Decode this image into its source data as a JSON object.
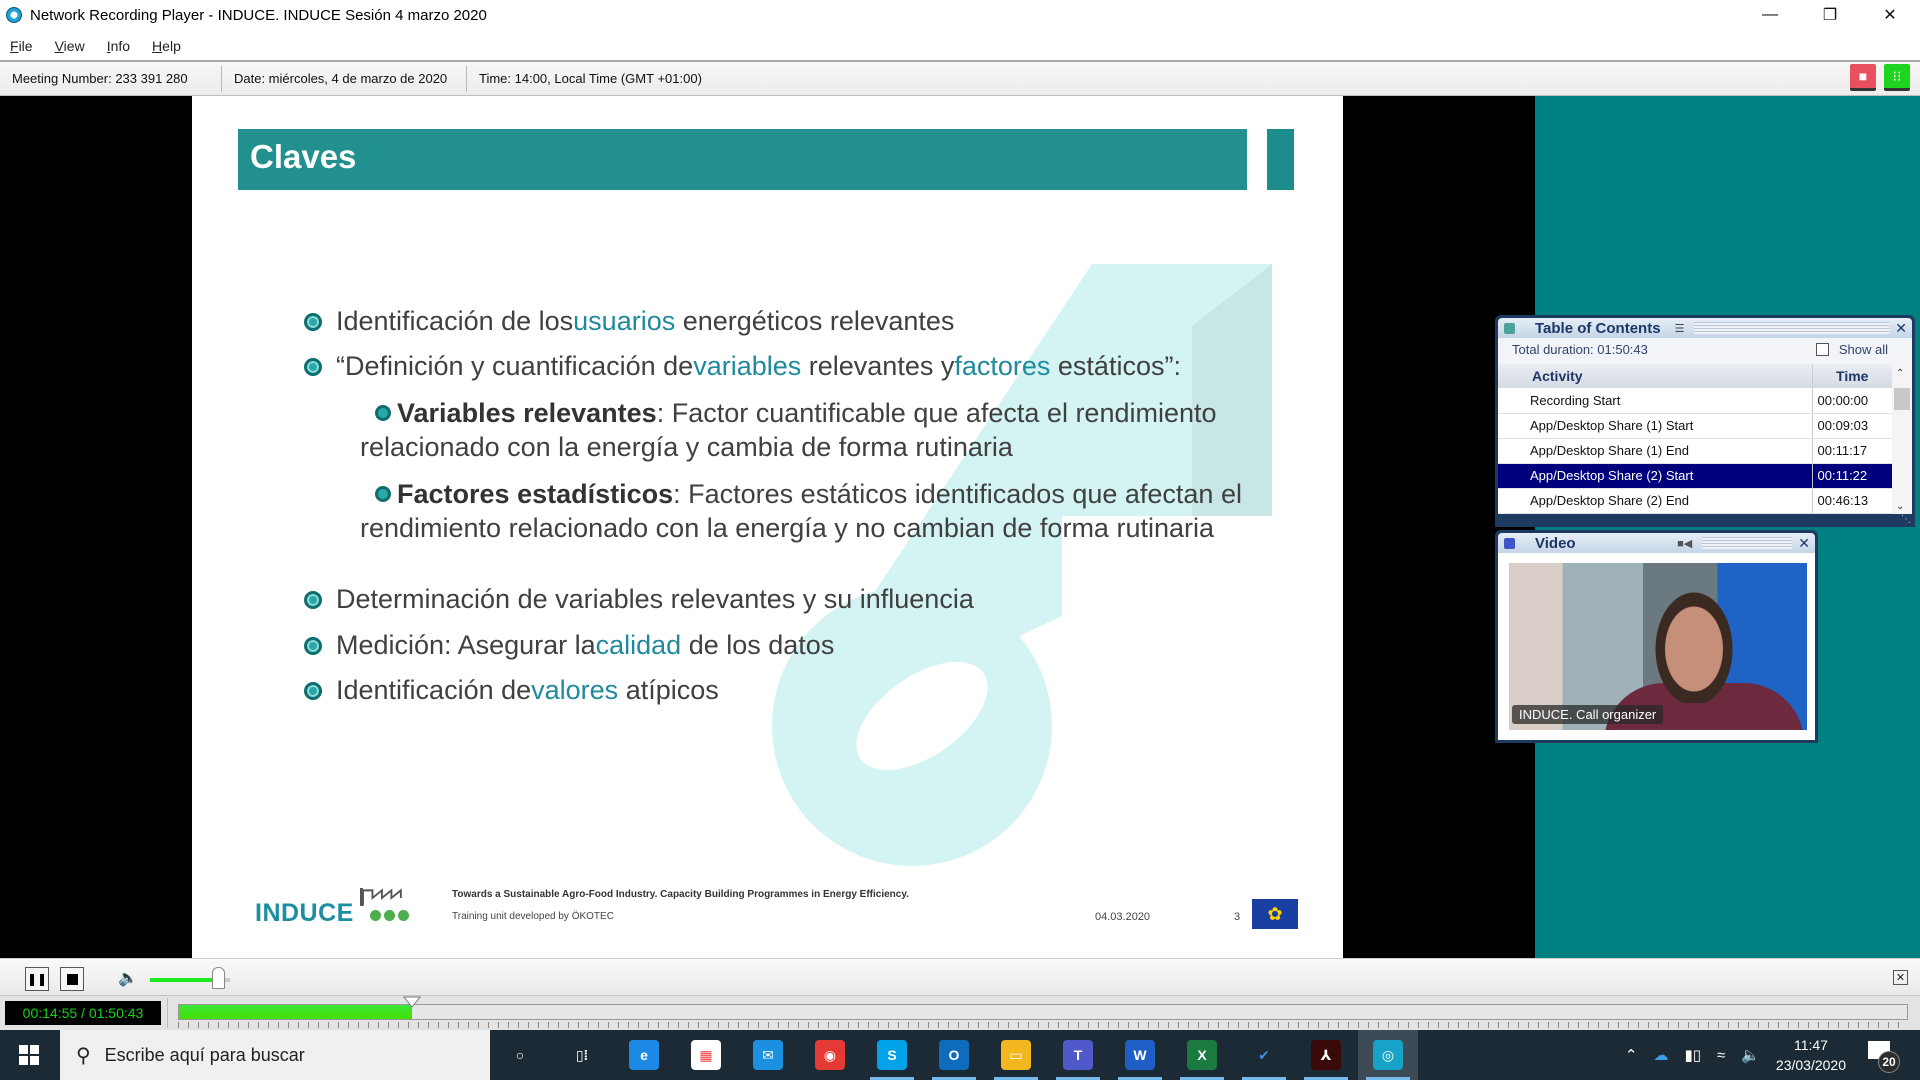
{
  "window": {
    "title": "Network Recording Player - INDUCE. INDUCE Sesión 4 marzo 2020",
    "minimize_icon": "minimize-icon",
    "restore_icon": "restore-icon",
    "close_icon": "close-icon"
  },
  "menu": [
    {
      "underline": "F",
      "rest": "ile"
    },
    {
      "underline": "V",
      "rest": "iew"
    },
    {
      "underline": "I",
      "rest": "nfo"
    },
    {
      "underline": "H",
      "rest": "elp"
    }
  ],
  "info_bar": {
    "meeting_number": "Meeting Number: 233 391 280",
    "date": "Date: miércoles, 4 de marzo de 2020",
    "time": "Time: 14:00, Local Time (GMT +01:00)",
    "chat_icon": "chat-icon",
    "participants_icon": "participants-icon",
    "colors": {
      "chat": "#e8505f",
      "participants": "#1ed41e"
    }
  },
  "slide": {
    "title": "Claves",
    "accent_color": "#21908f",
    "highlight_color": "#1e8a9c",
    "bullets": [
      {
        "parts": [
          "Identificación de los ",
          "usuarios",
          " energéticos relevantes"
        ]
      },
      {
        "parts": [
          "“Definición y cuantificación de ",
          "variables",
          " relevantes y ",
          "factores",
          " estáticos”:"
        ]
      },
      {
        "bold": "Variables relevantes",
        "text": ": Factor cuantificable que afecta el rendimiento relacionado con la energía y cambia de forma rutinaria"
      },
      {
        "bold": "Factores estadísticos",
        "text": ": Factores estáticos identificados que afectan el rendimiento relacionado con la energía y no cambian de forma rutinaria"
      },
      {
        "parts": [
          "Determinación de variables relevantes y su influencia"
        ]
      },
      {
        "parts": [
          "Medición: Asegurar la ",
          "calidad",
          " de los datos"
        ]
      },
      {
        "parts": [
          "Identificación de ",
          "valores",
          " atípicos"
        ]
      }
    ],
    "footer": {
      "logo_text": "INDUCE",
      "line1": "Towards a Sustainable Agro-Food Industry. Capacity Building Programmes in Energy Efficiency.",
      "line2": "Training unit developed by ÖKOTEC",
      "date": "04.03.2020",
      "page": "3",
      "flag_icon": "eu-flag-icon"
    }
  },
  "toc": {
    "title": "Table of Contents",
    "total_duration": "Total duration: 01:50:43",
    "show_all_label": "Show all",
    "show_all_checked": false,
    "columns": [
      "Activity",
      "Time"
    ],
    "rows": [
      {
        "activity": "Recording Start",
        "time": "00:00:00",
        "selected": false
      },
      {
        "activity": "App/Desktop Share (1) Start",
        "time": "00:09:03",
        "selected": false
      },
      {
        "activity": "App/Desktop Share (1) End",
        "time": "00:11:17",
        "selected": false
      },
      {
        "activity": "App/Desktop Share (2) Start",
        "time": "00:11:22",
        "selected": true
      },
      {
        "activity": "App/Desktop Share (2) End",
        "time": "00:46:13",
        "selected": false
      }
    ]
  },
  "video": {
    "title": "Video",
    "caption": "INDUCE. Call organizer"
  },
  "player": {
    "time_display": "00:14:55 / 01:50:43",
    "progress_percent": 13.5,
    "volume_percent": 85,
    "pause_icon": "pause-icon",
    "stop_icon": "stop-icon",
    "volume_icon": "speaker-icon"
  },
  "taskbar": {
    "search_placeholder": "Escribe aquí para buscar",
    "apps": [
      {
        "name": "cortana",
        "glyph": "○",
        "color": "transparent",
        "running": false
      },
      {
        "name": "task-view",
        "glyph": "▯⁞",
        "color": "transparent",
        "running": false
      },
      {
        "name": "edge",
        "glyph": "e",
        "color": "#1e88e5",
        "running": false
      },
      {
        "name": "store",
        "glyph": "▦",
        "color": "#ffffff",
        "running": false
      },
      {
        "name": "mail",
        "glyph": "✉",
        "color": "#1b8fe0",
        "running": false
      },
      {
        "name": "chrome",
        "glyph": "◉",
        "color": "#e53935",
        "running": false
      },
      {
        "name": "skype",
        "glyph": "S",
        "color": "#00a2e8",
        "running": true
      },
      {
        "name": "outlook",
        "glyph": "O",
        "color": "#0f6cbd",
        "running": true
      },
      {
        "name": "file-explorer",
        "glyph": "▭",
        "color": "#f3b820",
        "running": true
      },
      {
        "name": "teams",
        "glyph": "T",
        "color": "#5059c9",
        "running": true
      },
      {
        "name": "word",
        "glyph": "W",
        "color": "#1f5ec4",
        "running": true
      },
      {
        "name": "excel",
        "glyph": "X",
        "color": "#1a7a3f",
        "running": true
      },
      {
        "name": "todo",
        "glyph": "✔",
        "color": "transparent",
        "running": true
      },
      {
        "name": "acrobat",
        "glyph": "⅄",
        "color": "#3a0a0a",
        "running": true
      },
      {
        "name": "webex-player",
        "glyph": "◎",
        "color": "#16a3c7",
        "running": true,
        "active": true
      }
    ],
    "clock_time": "11:47",
    "clock_date": "23/03/2020",
    "notification_count": "20"
  }
}
